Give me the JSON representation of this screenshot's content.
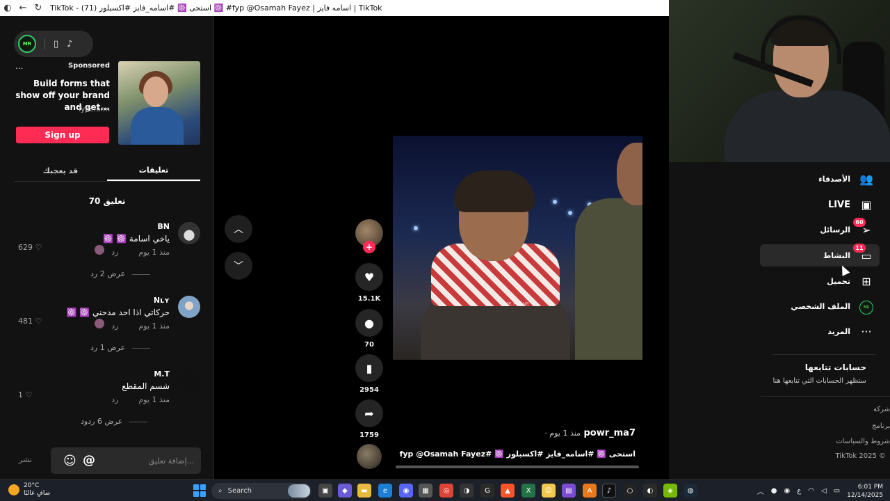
{
  "browser": {
    "title": "TikTok - (71) استحى ☸️ #اسامه_فايز #اكسبلور ☸️ #fyp @Osamah Fayez | اسامه فايز | TikTok"
  },
  "left_panel": {
    "ad": {
      "sponsored": "Sponsored",
      "title": "Build forms that show off your brand and get...",
      "brand": "Typeform",
      "cta": "Sign up",
      "more": "..."
    },
    "tabs": [
      {
        "label": "قد يعجبك",
        "active": false
      },
      {
        "label": "تعليقات",
        "active": true
      }
    ],
    "comment_count": "70 تعليق",
    "comments": [
      {
        "user": "BN",
        "text": "ياخي اسامة ☸️ ☸️",
        "time": "منذ 1 يوم",
        "reply": "رد",
        "likes": "629",
        "replies": "عرض 2 رد"
      },
      {
        "user": "Nʟʏ",
        "text": "حركاتي اذا احد مدحني ☸️ ☸️",
        "time": "منذ 1 يوم",
        "reply": "رد",
        "likes": "481",
        "replies": "عرض 1 رد"
      },
      {
        "user": "M.T",
        "text": "شسم المقطع",
        "time": "منذ 1 يوم",
        "reply": "رد",
        "likes": "1",
        "replies": "عرض 6 ردود"
      }
    ],
    "comment_input_placeholder": "إضافة تعليق...",
    "post_label": "نشر",
    "emoji_symbol": "☺",
    "mention_symbol": "@"
  },
  "feed": {
    "actions": {
      "likes": "15.1K",
      "comments": "70",
      "saves": "2954",
      "shares": "1759"
    },
    "author": "powr_ma7",
    "time": "· منذ 1 يوم",
    "caption": "استحى ☸️ #اسامه_فايز #اكسبلور ☸️ #fyp @Osamah Fayez",
    "watermark": "MR FLONE"
  },
  "right_nav": {
    "items": [
      {
        "label": "الأصدقاء",
        "icon": "friends-icon",
        "badge": ""
      },
      {
        "label": "LIVE",
        "icon": "live-icon",
        "badge": ""
      },
      {
        "label": "الرسائل",
        "icon": "messages-icon",
        "badge": "60"
      },
      {
        "label": "النشاط",
        "icon": "activity-icon",
        "badge": "11"
      },
      {
        "label": "تحميل",
        "icon": "upload-icon",
        "badge": ""
      },
      {
        "label": "الملف الشخصي",
        "icon": "profile-icon",
        "badge": ""
      },
      {
        "label": "المزيد",
        "icon": "more-icon",
        "badge": ""
      }
    ],
    "following_header": "حسابات تتابعها",
    "following_sub": "ستظهر الحسابات التي تتابعها هنا",
    "footer": [
      "شركة",
      "برنامج",
      "شروط والسياسات",
      "TikTok 2025 ©"
    ]
  },
  "taskbar": {
    "weather_temp": "20°C",
    "weather_desc": "صافٍ غالبًا",
    "search": "Search",
    "time": "6:01 PM",
    "date": "12/14/2025",
    "lang": "ع"
  },
  "colors": {
    "accent": "#fe2c55",
    "bg": "#121212"
  }
}
